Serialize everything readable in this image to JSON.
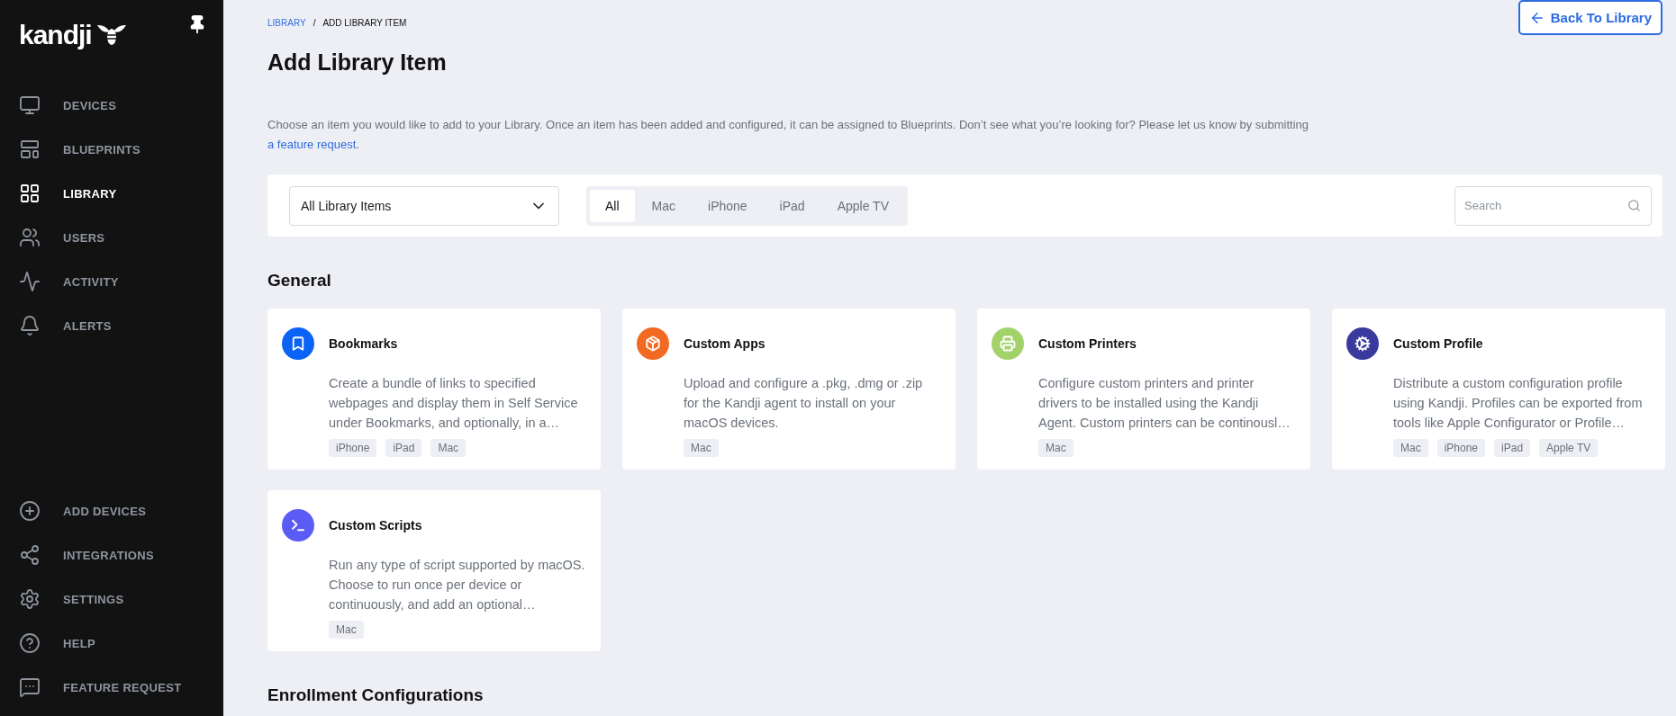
{
  "sidebar": {
    "logo": "kandji",
    "nav_items": [
      {
        "label": "DEVICES",
        "kind": "devices",
        "selected": false
      },
      {
        "label": "BLUEPRINTS",
        "kind": "blueprints",
        "selected": false
      },
      {
        "label": "LIBRARY",
        "kind": "library",
        "selected": true
      },
      {
        "label": "USERS",
        "kind": "users",
        "selected": false
      },
      {
        "label": "ACTIVITY",
        "kind": "activity",
        "selected": false
      },
      {
        "label": "ALERTS",
        "kind": "alerts",
        "selected": false
      }
    ],
    "bottom_items": [
      {
        "label": "ADD DEVICES",
        "kind": "add"
      },
      {
        "label": "INTEGRATIONS",
        "kind": "integrations"
      },
      {
        "label": "SETTINGS",
        "kind": "settings"
      },
      {
        "label": "HELP",
        "kind": "help"
      },
      {
        "label": "FEATURE REQUEST",
        "kind": "feedback"
      }
    ]
  },
  "breadcrumb": [
    {
      "label": "LIBRARY",
      "link": true
    },
    {
      "label": "/",
      "link": false
    },
    {
      "label": "ADD LIBRARY ITEM",
      "link": false
    }
  ],
  "back_button": "Back To Library",
  "title": "Add Library Item",
  "intro": {
    "text": "Choose an item you would like to add to your Library. Once an item has been added and configured, it can be assigned to Blueprints. Don’t see what you’re looking for? Please let us know by submitting ",
    "link": "a feature request",
    "end": "."
  },
  "filter": {
    "dropdown": "All Library Items",
    "tabs": [
      {
        "label": "All",
        "selected": true
      },
      {
        "label": "Mac",
        "selected": false
      },
      {
        "label": "iPhone",
        "selected": false
      },
      {
        "label": "iPad",
        "selected": false
      },
      {
        "label": "Apple TV",
        "selected": false
      }
    ],
    "search": {
      "placeholder": "Search"
    }
  },
  "sections": [
    {
      "title": "General",
      "items": [
        {
          "name": "Bookmarks",
          "kind": "bookmark",
          "color": "#0b63f6",
          "description": "Create a bundle of links to specified webpages and display them in Self Service under Bookmarks, and optionally, in a…",
          "tags": [
            "iPhone",
            "iPad",
            "Mac"
          ]
        },
        {
          "name": "Custom Apps",
          "kind": "box",
          "color": "#f26a21",
          "description": "Upload and configure a .pkg, .dmg or .zip for the Kandji agent to install on your macOS devices.",
          "tags": [
            "Mac"
          ]
        },
        {
          "name": "Custom Printers",
          "kind": "printer",
          "color": "#a3d26b",
          "description": "Configure custom printers and printer drivers to be installed using the Kandji Agent. Custom printers can be continousl…",
          "tags": [
            "Mac"
          ]
        },
        {
          "name": "Custom Profile",
          "kind": "gear",
          "color": "#3a3a9e",
          "description": "Distribute a custom configuration profile using Kandji. Profiles can be exported from tools like Apple Configurator or Profile…",
          "tags": [
            "Mac",
            "iPhone",
            "iPad",
            "Apple TV"
          ]
        },
        {
          "name": "Custom Scripts",
          "kind": "terminal",
          "color": "#5b5bf5",
          "description": "Run any type of script supported by macOS. Choose to run once per device or continuously, and add an optional…",
          "tags": [
            "Mac"
          ]
        }
      ]
    },
    {
      "title": "Enrollment Configurations"
    }
  ]
}
